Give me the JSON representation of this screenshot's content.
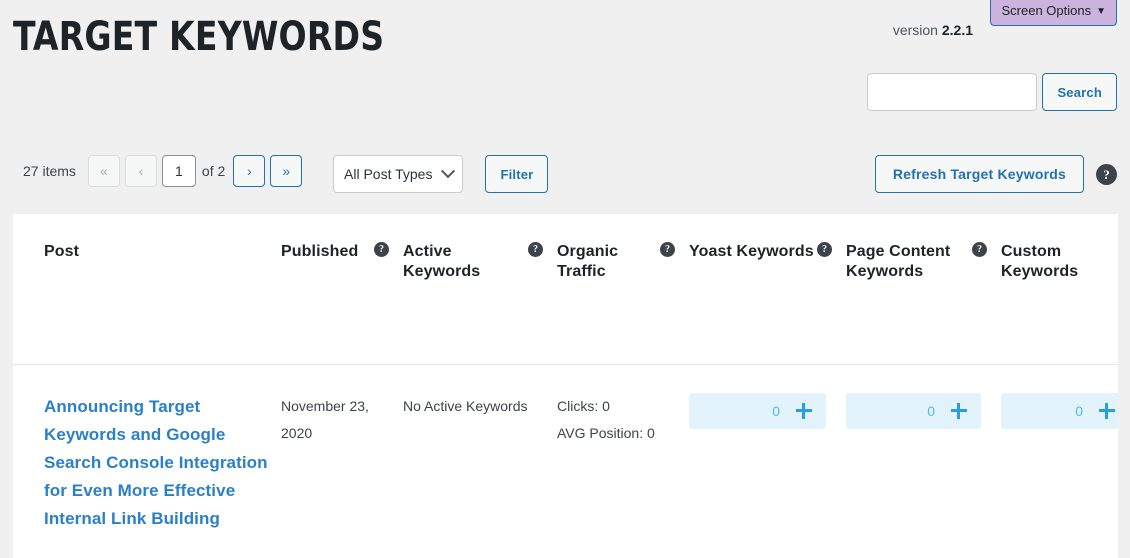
{
  "screen_options": {
    "label": "Screen Options",
    "caret": "▼"
  },
  "page_title": "Target Keywords",
  "version": {
    "prefix": "version",
    "number": "2.2.1"
  },
  "search": {
    "value": "",
    "placeholder": "",
    "button_label": "Search"
  },
  "pagination": {
    "items_count": "27 items",
    "first_label": "«",
    "prev_label": "‹",
    "current_page": "1",
    "of_label": "of 2",
    "next_label": "›",
    "last_label": "»"
  },
  "filters": {
    "post_type_selected": "All Post Types",
    "filter_button": "Filter"
  },
  "actions": {
    "refresh_label": "Refresh Target Keywords",
    "help_glyph": "?"
  },
  "table": {
    "columns": [
      {
        "label": "Post",
        "help": false
      },
      {
        "label": "Published",
        "help": true
      },
      {
        "label": "Active Keywords",
        "help": true
      },
      {
        "label": "Organic Traffic",
        "help": true
      },
      {
        "label": "Yoast Keywords",
        "help": true
      },
      {
        "label": "Page Content Keywords",
        "help": true
      },
      {
        "label": "Custom Keywords",
        "help": true
      }
    ],
    "rows": [
      {
        "post_title": "Announcing Target Keywords and Google Search Console Integration for Even More Effective Internal Link Building",
        "published": "November 23, 2020",
        "active_keywords": "No Active Keywords",
        "organic_clicks": "Clicks: 0",
        "organic_avg_position": "AVG Position: 0",
        "yoast_count": "0",
        "page_content_count": "0",
        "custom_count": "0"
      }
    ]
  },
  "colors": {
    "accent_blue": "#2271b1",
    "link_blue": "#2a7fc9",
    "count_bg": "#e2f3fb",
    "screen_options_bg": "#cbb3dd",
    "page_bg": "#f0f0f1"
  }
}
